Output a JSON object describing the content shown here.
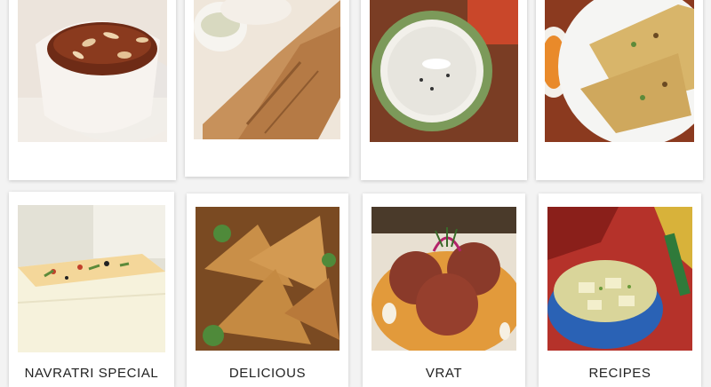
{
  "cards": [
    {
      "label": "",
      "image": "sheera-halwa-bowl"
    },
    {
      "label": "",
      "image": "masala-dosa"
    },
    {
      "label": "",
      "image": "sabudana-kheer"
    },
    {
      "label": "",
      "image": "thalipeeth-paratha"
    },
    {
      "label": "NAVRATRI SPECIAL",
      "image": "dhokla"
    },
    {
      "label": "DELICIOUS",
      "image": "samosa"
    },
    {
      "label": "VRAT",
      "image": "vrat-kofta"
    },
    {
      "label": "RECIPES",
      "image": "paneer-curry-bowl"
    }
  ]
}
